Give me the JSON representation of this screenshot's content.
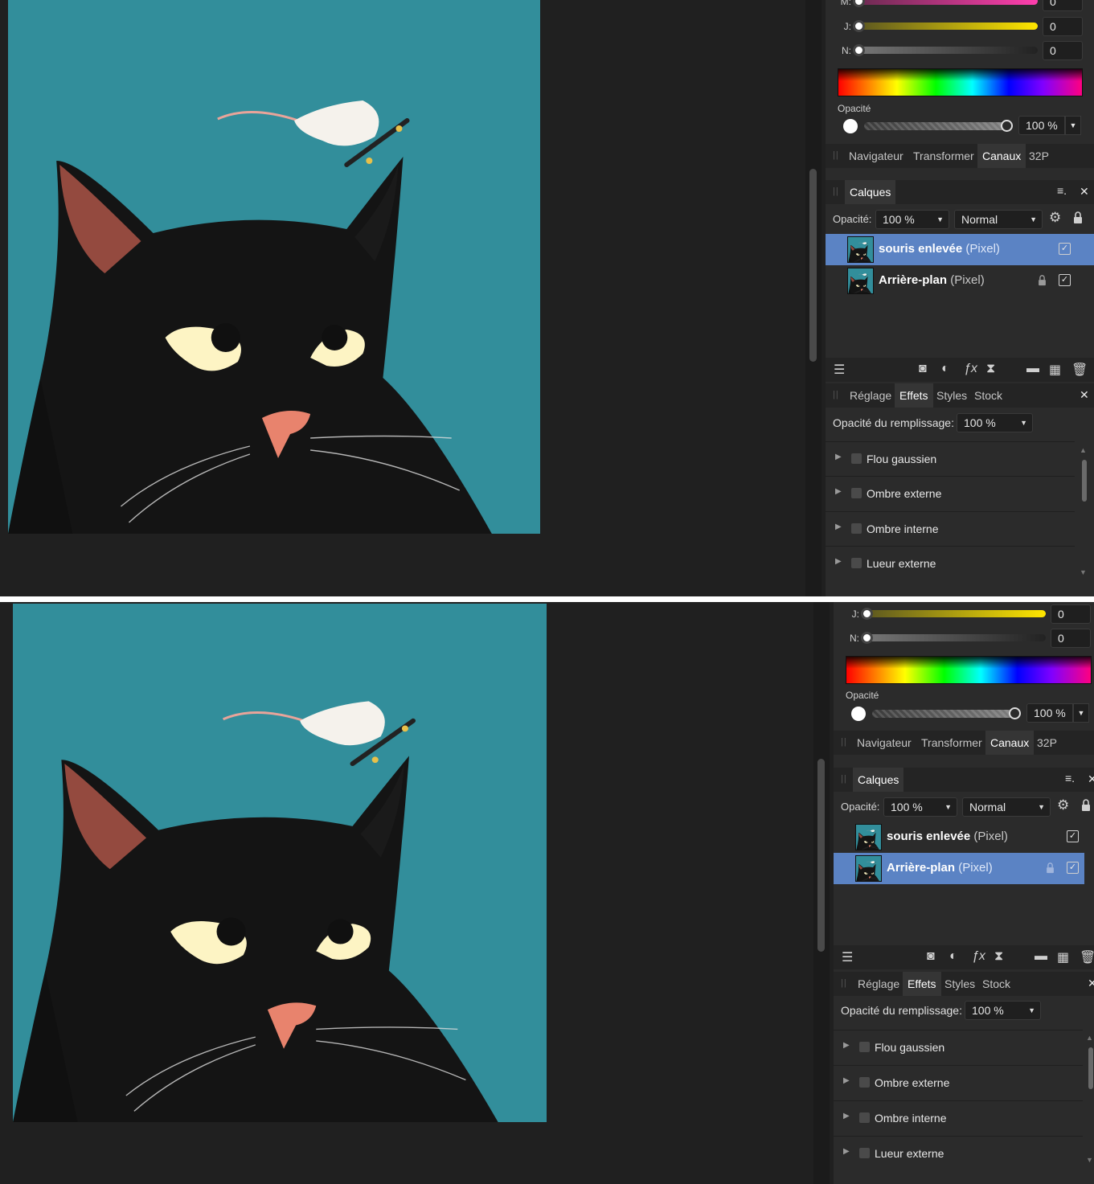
{
  "color_panel": {
    "channels": [
      {
        "label": "M:",
        "value": "0",
        "color": "#ff3fae"
      },
      {
        "label": "J:",
        "value": "0",
        "color": "#ffe600"
      },
      {
        "label": "N:",
        "value": "0",
        "color": "#2a2a2a"
      }
    ],
    "opacity_label": "Opacité",
    "opacity_value": "100 %"
  },
  "top_tabs": [
    "Navigateur",
    "Transformer",
    "Canaux",
    "32P"
  ],
  "top_tabs_active": "Canaux",
  "layers_panel": {
    "title": "Calques",
    "opacity_label": "Opacité:",
    "opacity_value": "100 %",
    "blend_mode": "Normal",
    "layers": [
      {
        "name": "souris enlevée",
        "kind": "(Pixel)"
      },
      {
        "name": "Arrière-plan",
        "kind": "(Pixel)"
      }
    ]
  },
  "effects_panel": {
    "tabs": [
      "Réglage",
      "Effets",
      "Styles",
      "Stock"
    ],
    "active_tab": "Effets",
    "fill_opacity_label": "Opacité du remplissage:",
    "fill_opacity_value": "100 %",
    "effects": [
      "Flou gaussien",
      "Ombre externe",
      "Ombre interne",
      "Lueur externe"
    ]
  },
  "states": [
    {
      "selected_layer": "souris enlevée"
    },
    {
      "selected_layer": "Arrière-plan"
    }
  ],
  "colors": {
    "selection": "#5b83c4",
    "background": "#202020",
    "panel": "#2b2b2b",
    "canvas_teal": "#2f8a97"
  }
}
